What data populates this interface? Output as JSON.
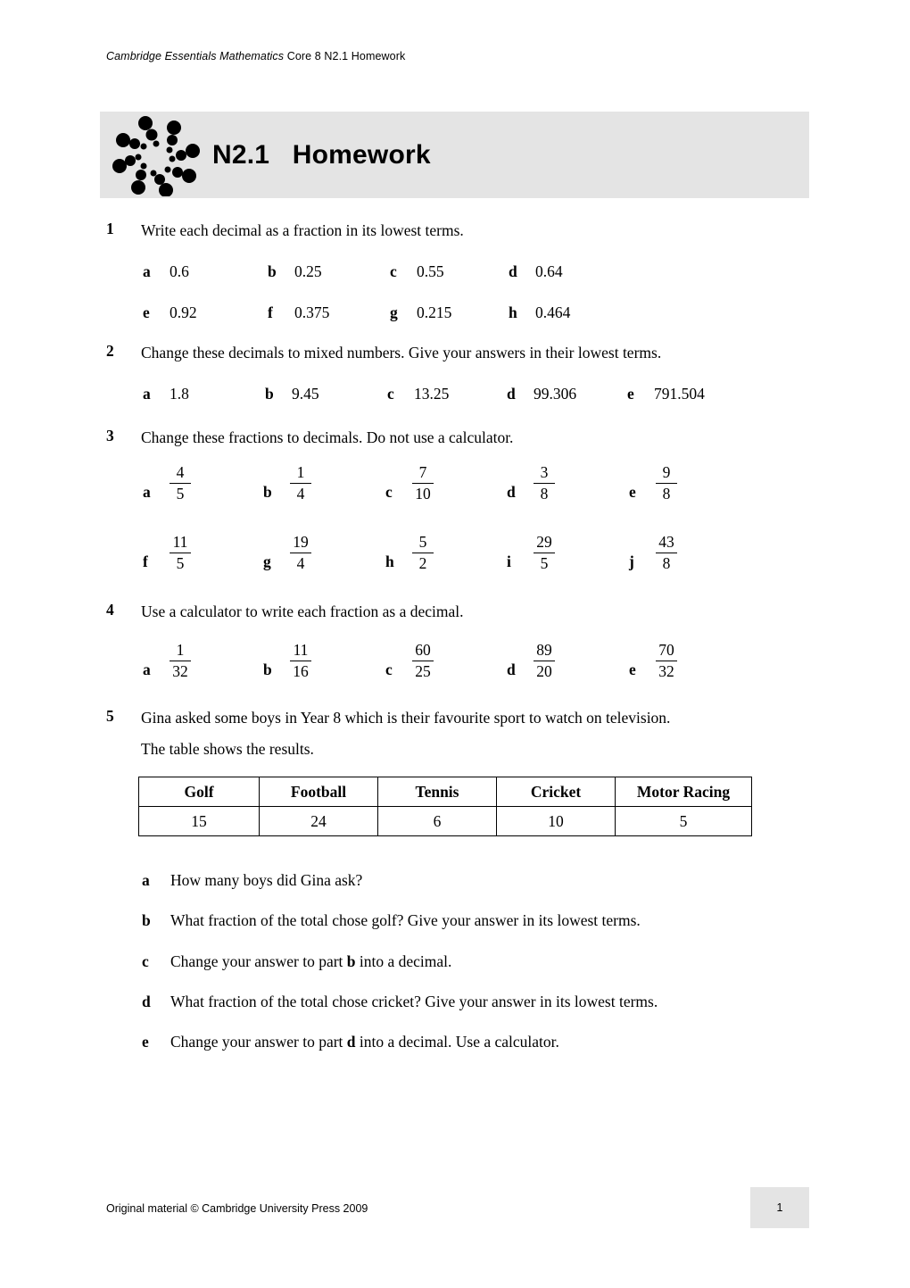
{
  "header": {
    "italic_part": "Cambridge Essentials Mathematics",
    "plain_part": " Core 8 N2.1 Homework"
  },
  "banner": {
    "title": "N2.1   Homework",
    "logo_name": "cambridge-essentials-pinwheel-logo",
    "background_color": "#e4e4e4"
  },
  "questions": [
    {
      "number": "1",
      "text": "Write each decimal as a fraction in its lowest terms.",
      "rows": [
        [
          {
            "letter": "a",
            "value": "0.6"
          },
          {
            "letter": "b",
            "value": "0.25"
          },
          {
            "letter": "c",
            "value": "0.55"
          },
          {
            "letter": "d",
            "value": "0.64"
          }
        ],
        [
          {
            "letter": "e",
            "value": "0.92"
          },
          {
            "letter": "f",
            "value": "0.375"
          },
          {
            "letter": "g",
            "value": "0.215"
          },
          {
            "letter": "h",
            "value": "0.464"
          }
        ]
      ]
    },
    {
      "number": "2",
      "text": "Change these decimals to mixed numbers. Give your answers in their lowest terms.",
      "rows": [
        [
          {
            "letter": "a",
            "value": "1.8"
          },
          {
            "letter": "b",
            "value": "9.45"
          },
          {
            "letter": "c",
            "value": "13.25"
          },
          {
            "letter": "d",
            "value": "99.306"
          },
          {
            "letter": "e",
            "value": "791.504"
          }
        ]
      ]
    },
    {
      "number": "3",
      "text": "Change these fractions to decimals. Do not use a calculator.",
      "fraction_rows": [
        [
          {
            "letter": "a",
            "numerator": "4",
            "denominator": "5"
          },
          {
            "letter": "b",
            "numerator": "1",
            "denominator": "4"
          },
          {
            "letter": "c",
            "numerator": "7",
            "denominator": "10"
          },
          {
            "letter": "d",
            "numerator": "3",
            "denominator": "8"
          },
          {
            "letter": "e",
            "numerator": "9",
            "denominator": "8"
          }
        ],
        [
          {
            "letter": "f",
            "numerator": "11",
            "denominator": "5"
          },
          {
            "letter": "g",
            "numerator": "19",
            "denominator": "4"
          },
          {
            "letter": "h",
            "numerator": "5",
            "denominator": "2"
          },
          {
            "letter": "i",
            "numerator": "29",
            "denominator": "5"
          },
          {
            "letter": "j",
            "numerator": "43",
            "denominator": "8"
          }
        ]
      ]
    },
    {
      "number": "4",
      "text": "Use a calculator to write each fraction as a decimal.",
      "fraction_rows": [
        [
          {
            "letter": "a",
            "numerator": "1",
            "denominator": "32"
          },
          {
            "letter": "b",
            "numerator": "11",
            "denominator": "16"
          },
          {
            "letter": "c",
            "numerator": "60",
            "denominator": "25"
          },
          {
            "letter": "d",
            "numerator": "89",
            "denominator": "20"
          },
          {
            "letter": "e",
            "numerator": "70",
            "denominator": "32"
          }
        ]
      ]
    },
    {
      "number": "5",
      "text_line1": "Gina asked some boys in Year 8 which is their favourite sport to watch on television.",
      "text_line2": "The table shows the results."
    }
  ],
  "table": {
    "headers": [
      "Golf",
      "Football",
      "Tennis",
      "Cricket",
      "Motor Racing"
    ],
    "values": [
      "15",
      "24",
      "6",
      "10",
      "5"
    ]
  },
  "subparts": [
    {
      "letter": "a",
      "pre": "How many boys did Gina ask?",
      "bold": "",
      "post": ""
    },
    {
      "letter": "b",
      "pre": "What fraction of the total chose golf? Give your answer in its lowest terms.",
      "bold": "",
      "post": ""
    },
    {
      "letter": "c",
      "pre": "Change your answer to part ",
      "bold": "b",
      "post": " into a decimal."
    },
    {
      "letter": "d",
      "pre": "What fraction of the total chose cricket? Give your answer in its lowest terms.",
      "bold": "",
      "post": ""
    },
    {
      "letter": "e",
      "pre": "Change your answer to part ",
      "bold": "d",
      "post": " into a decimal. Use a calculator."
    }
  ],
  "footer": {
    "copyright": "Original material © Cambridge University Press 2009",
    "page_number": "1"
  }
}
